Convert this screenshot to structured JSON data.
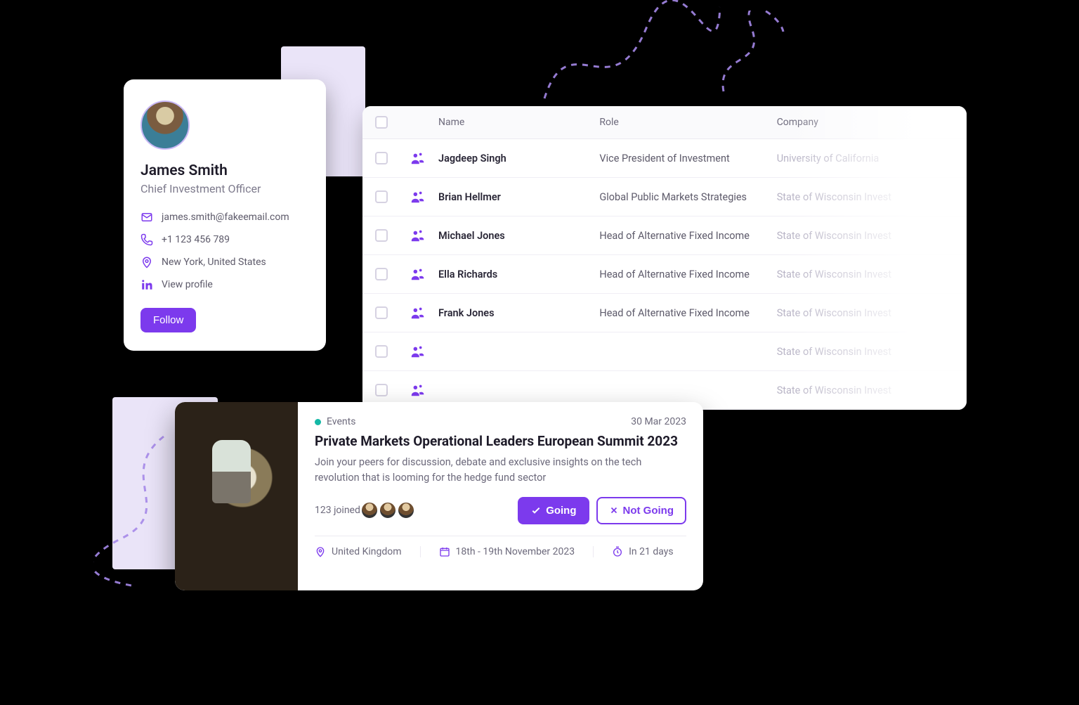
{
  "profile": {
    "name": "James Smith",
    "role": "Chief Investment Officer",
    "email": "james.smith@fakeemail.com",
    "phone": "+1 123 456 789",
    "location": "New York, United States",
    "linkedin_label": "View profile",
    "follow_label": "Follow"
  },
  "table": {
    "headers": {
      "name": "Name",
      "role": "Role",
      "company": "Company"
    },
    "rows": [
      {
        "name": "Jagdeep Singh",
        "role": "Vice President of Investment",
        "company": "University of California"
      },
      {
        "name": "Brian Hellmer",
        "role": "Global Public Markets Strategies",
        "company": "State of Wisconsin Invest"
      },
      {
        "name": "Michael Jones",
        "role": "Head of Alternative Fixed Income",
        "company": "State of Wisconsin Invest"
      },
      {
        "name": "Ella Richards",
        "role": "Head of Alternative Fixed Income",
        "company": "State of Wisconsin Invest"
      },
      {
        "name": "Frank Jones",
        "role": "Head of Alternative Fixed Income",
        "company": "State of Wisconsin Invest"
      },
      {
        "name": "",
        "role": "",
        "company": "State of Wisconsin Invest"
      },
      {
        "name": "",
        "role": "",
        "company": "State of Wisconsin Invest"
      }
    ]
  },
  "event": {
    "category": "Events",
    "date": "30 Mar 2023",
    "title": "Private Markets Operational Leaders European Summit 2023",
    "description": "Join your peers for discussion, debate and exclusive insights on the tech revolution that is looming for the hedge fund sector",
    "joined_label": "123 joined",
    "going_label": "Going",
    "notgoing_label": "Not Going",
    "location": "United Kingdom",
    "dates_range": "18th - 19th November 2023",
    "countdown": "In 21 days"
  },
  "colors": {
    "accent": "#7c3aed",
    "teal": "#14b8a6"
  }
}
